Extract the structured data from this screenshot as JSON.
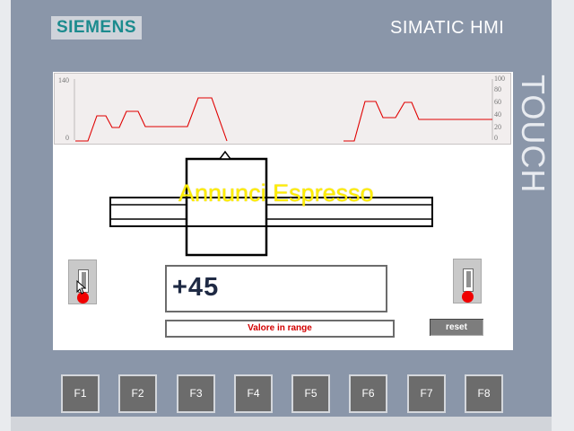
{
  "brand": {
    "logo": "SIEMENS",
    "model": "SIMATIC HMI",
    "touch": "TOUCH"
  },
  "trend": {
    "left_axis": {
      "top": "140",
      "bottom": "0"
    },
    "right_axis": [
      "100",
      "80",
      "60",
      "40",
      "20",
      "0"
    ],
    "line_color": "#e00000"
  },
  "overlay_text": "Annunci Espresso",
  "value_display": "+45",
  "status_message": "Valore in range",
  "reset_label": "reset",
  "function_keys": [
    "F1",
    "F2",
    "F3",
    "F4",
    "F5",
    "F6",
    "F7",
    "F8"
  ],
  "colors": {
    "panel": "#8a96a9",
    "status_text": "#d20000",
    "led": "#f00000",
    "overlay": "#ffee00"
  }
}
